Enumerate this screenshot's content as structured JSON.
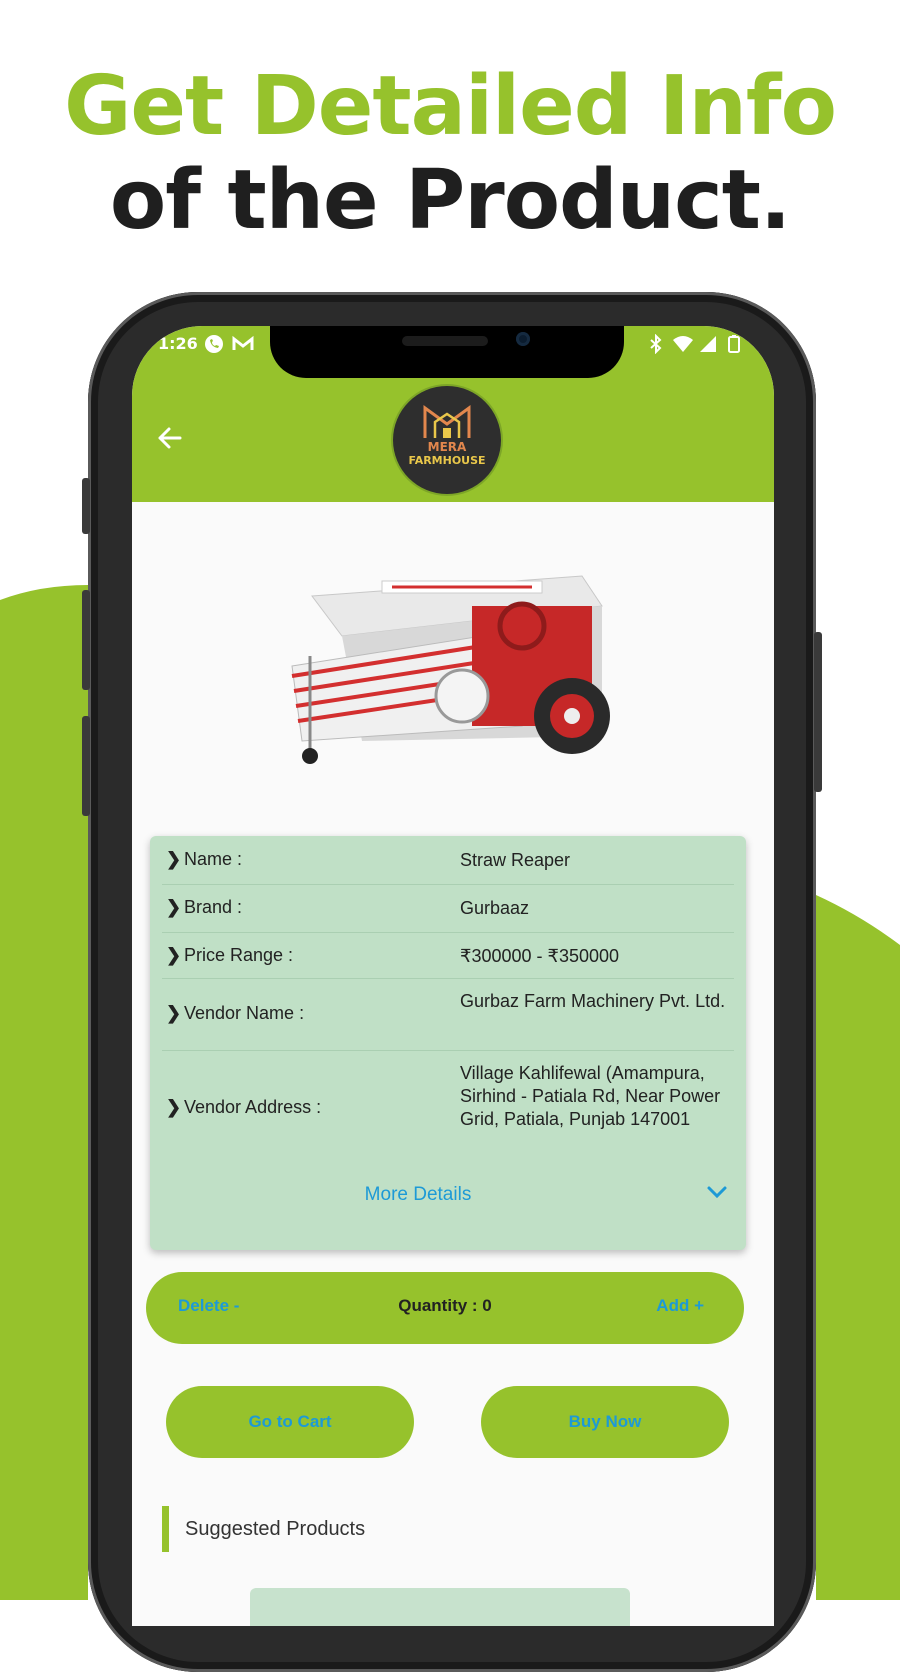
{
  "headline": {
    "line1": "Get Detailed Info",
    "line2": "of the Product."
  },
  "status_bar": {
    "time": "1:26",
    "left_icons": [
      "whatsapp-icon",
      "gmail-icon"
    ],
    "right_icons": [
      "bluetooth-icon",
      "wifi-icon",
      "signal-icon",
      "battery-icon"
    ]
  },
  "app_bar": {
    "logo_line1": "MERA",
    "logo_line2": "FARMHOUSE"
  },
  "details": [
    {
      "label": "Name :",
      "value": "Straw Reaper"
    },
    {
      "label": "Brand :",
      "value": "Gurbaaz"
    },
    {
      "label": "Price Range :",
      "value": "₹300000 - ₹350000"
    },
    {
      "label": "Vendor Name :",
      "value": "Gurbaz Farm Machinery Pvt. Ltd."
    },
    {
      "label": "Vendor Address :",
      "value": "Village Kahlifewal (Amampura, Sirhind - Patiala Rd, Near Power Grid, Patiala, Punjab 147001"
    }
  ],
  "more_details_label": "More Details",
  "quantity_bar": {
    "delete_label": "Delete -",
    "quantity_label": "Quantity : 0",
    "add_label": "Add +"
  },
  "actions": {
    "go_to_cart": "Go to Cart",
    "buy_now": "Buy Now"
  },
  "suggested_heading": "Suggested Products",
  "colors": {
    "brand_green": "#96c22c",
    "card_green": "#c0e0c6",
    "link_blue": "#1d9ad6"
  }
}
